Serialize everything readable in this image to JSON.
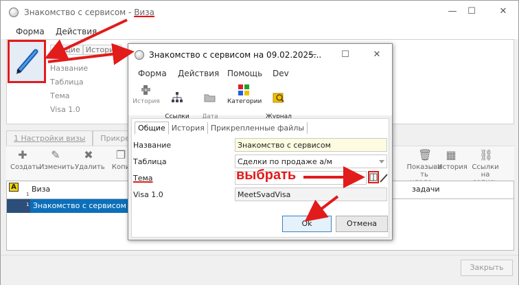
{
  "back_window": {
    "title_prefix": "Знакомство с сервисом - ",
    "title_suffix": "Виза",
    "menu": [
      "Форма",
      "Действия"
    ],
    "small_tabs": [
      "Общие",
      "История"
    ],
    "labels": [
      "Название",
      "Таблица",
      "Тема",
      "Visa 1.0"
    ],
    "tabs": [
      "1 Настройки визы",
      "Прикрепленные"
    ],
    "toolbar_left": [
      "Создать",
      "Изменить",
      "Удалить",
      "Копи"
    ],
    "toolbar_right": [
      "Показыва\nть удале...",
      "История",
      "Ссылки на\nзапись"
    ],
    "grid": {
      "badge": "A",
      "col_viza": "Виза",
      "col_tasks": "задачи",
      "row_num_header": "1",
      "row_num": "1",
      "row1_viza": "Знакомство с сервисом"
    },
    "close_label": "Закрыть"
  },
  "dialog": {
    "title": "Знакомство с сервисом на 09.02.2025...",
    "menu": [
      "Форма",
      "Действия",
      "Помощь",
      "Dev"
    ],
    "toolbar": [
      {
        "label": "История",
        "icon": "history-icon",
        "active": false
      },
      {
        "label": "Ссылки на\nзапись",
        "icon": "links-icon",
        "active": true
      },
      {
        "label": "Дата\nдинам. з...",
        "icon": "folder-open-icon",
        "active": false
      },
      {
        "label": "Категории",
        "icon": "categories-icon",
        "active": true
      },
      {
        "label": "Журнал\nизменен ...",
        "icon": "journal-icon",
        "active": true
      }
    ],
    "tabs": [
      "Общие",
      "История",
      "Прикрепленные файлы"
    ],
    "fields": {
      "name_label": "Название",
      "name_value": "Знакомство с сервисом",
      "table_label": "Таблица",
      "table_value": "Сделки по продаже а/м",
      "theme_label": "Тема",
      "theme_value": "",
      "visa_label": "Visa 1.0",
      "visa_value": "MeetSvadVisa"
    },
    "ok_label": "Ok",
    "cancel_label": "Отмена"
  },
  "annotation": {
    "text": "выбрать",
    "color": "#e21b1b"
  }
}
